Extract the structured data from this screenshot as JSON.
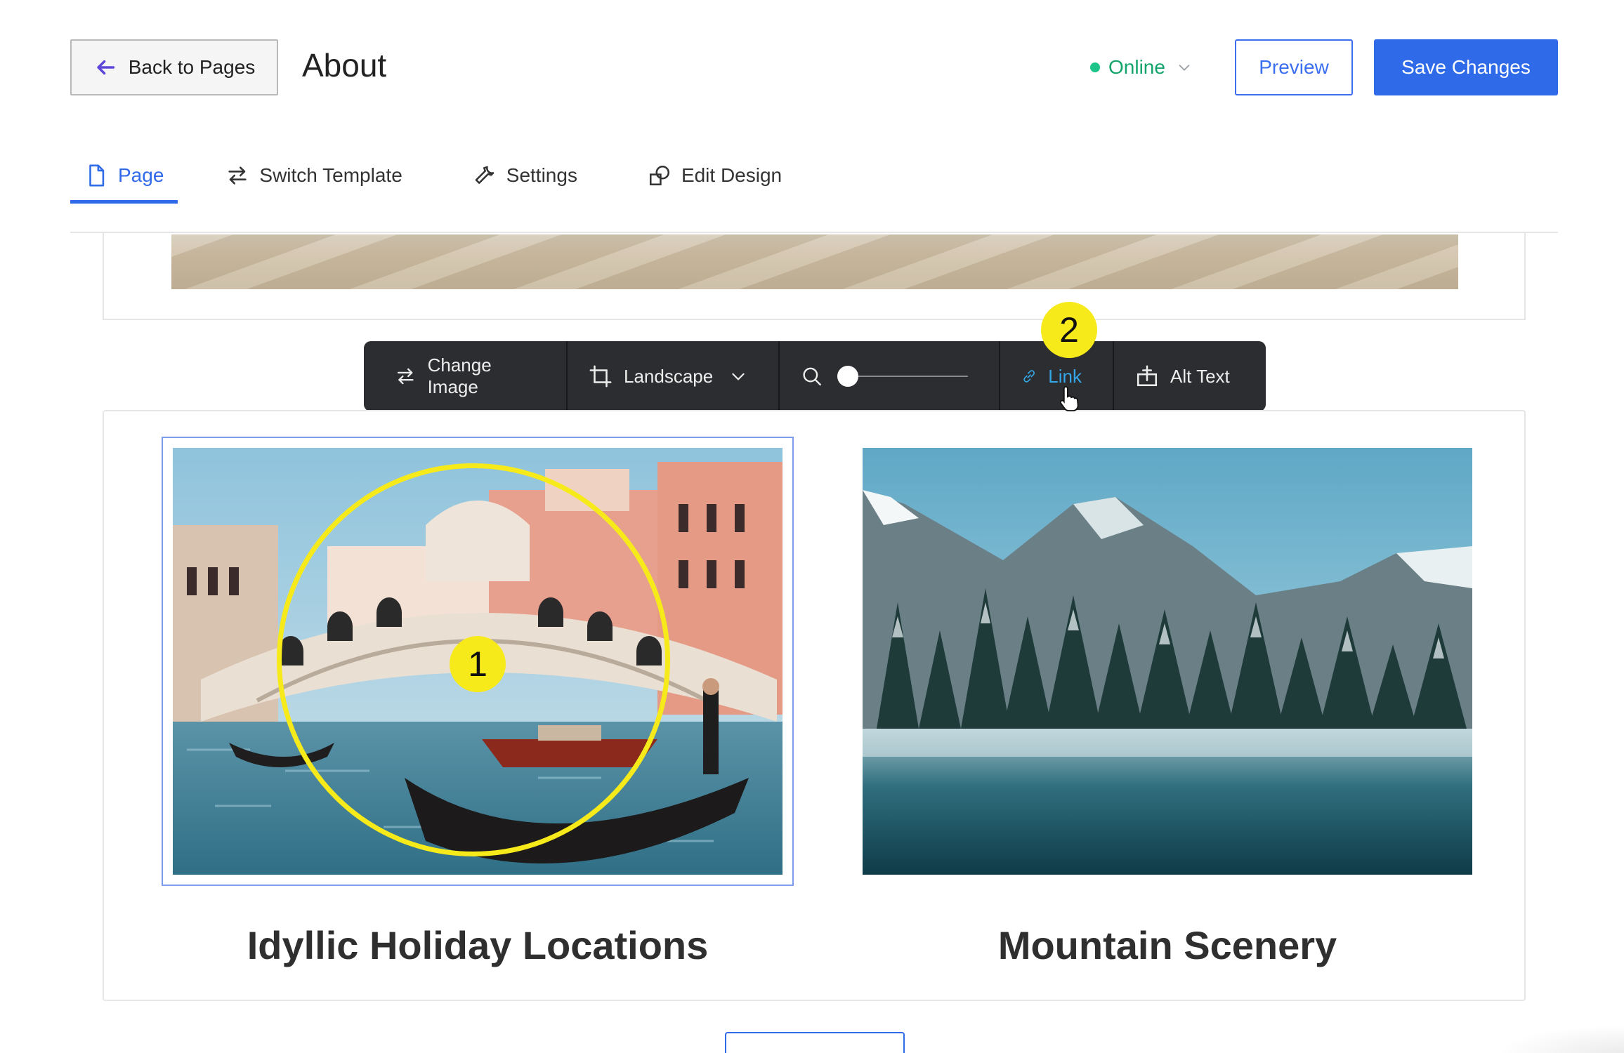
{
  "header": {
    "back_label": "Back to Pages",
    "page_title": "About",
    "status_label": "Online",
    "preview_label": "Preview",
    "save_label": "Save Changes"
  },
  "tabs": [
    {
      "label": "Page",
      "icon": "document-icon",
      "active": true
    },
    {
      "label": "Switch Template",
      "icon": "swap-arrows-icon",
      "active": false
    },
    {
      "label": "Settings",
      "icon": "wrench-icon",
      "active": false
    },
    {
      "label": "Edit Design",
      "icon": "design-shapes-icon",
      "active": false
    }
  ],
  "toolbar": {
    "change_image_label": "Change Image",
    "aspect_label": "Landscape",
    "zoom_level": 0,
    "link_label": "Link",
    "alt_text_label": "Alt Text"
  },
  "gallery": {
    "items": [
      {
        "caption": "Idyllic Holiday Locations",
        "image": "venice-rialto-bridge-gondola-photo",
        "selected": true
      },
      {
        "caption": "Mountain Scenery",
        "image": "snowy-forest-mountain-lake-photo",
        "selected": false
      }
    ]
  },
  "annotations": {
    "marker_1": "1",
    "marker_2": "2"
  },
  "colors": {
    "accent": "#2f6ae8",
    "status_online": "#1cc48a",
    "link_active": "#35a7e8",
    "toolbar_bg": "#2c2d30",
    "annotation_yellow": "#f7ea1a"
  }
}
